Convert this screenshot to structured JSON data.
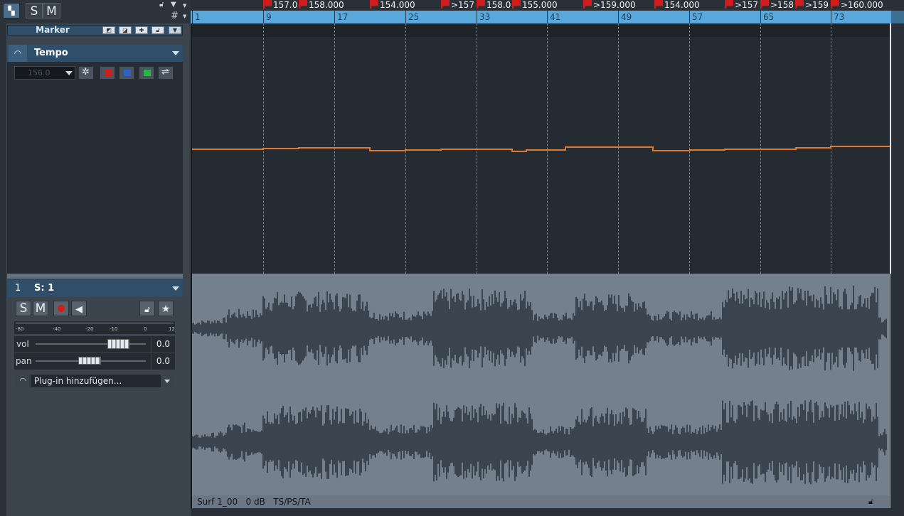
{
  "toolbar": {
    "solo_label": "S",
    "mute_label": "M",
    "grid_symbol": "#"
  },
  "marker_track": {
    "label": "Marker"
  },
  "tempo_track": {
    "title": "Tempo",
    "value": "156.0"
  },
  "audio_track": {
    "number": "1",
    "name": "S: 1",
    "solo_label": "S",
    "mute_label": "M",
    "meter_ticks": [
      "-80",
      "-40",
      "-20",
      "-10",
      "0",
      "12"
    ],
    "vol_label": "vol",
    "vol_value": "0.0",
    "pan_label": "pan",
    "pan_value": "0.0",
    "plugin_label": "Plug-in hinzufügen..."
  },
  "ruler": {
    "tempo_markers": [
      "157.0",
      "158.000",
      "154.000",
      ">157",
      "158.0",
      "155.000",
      ">159.000",
      "154.000",
      ">157",
      ">158",
      ">159",
      ">160.000"
    ],
    "bars": [
      "1",
      "9",
      "17",
      "25",
      "33",
      "41",
      "49",
      "57",
      "65",
      "73"
    ]
  },
  "clip": {
    "footer": "Surf 1_00   0 dB   TS/PS/TA"
  },
  "colors": {
    "tempo_curve": "#e07a2e",
    "header_blue": "#2f4e69",
    "ruler_blue": "#5aa8db",
    "waveform": "#2b3640"
  },
  "icons": {
    "top_left": "mixer-icon",
    "lock": "lock-icon",
    "star": "star-icon",
    "record": "record-icon",
    "monitor": "speaker-icon",
    "settings": "gear-icon"
  }
}
